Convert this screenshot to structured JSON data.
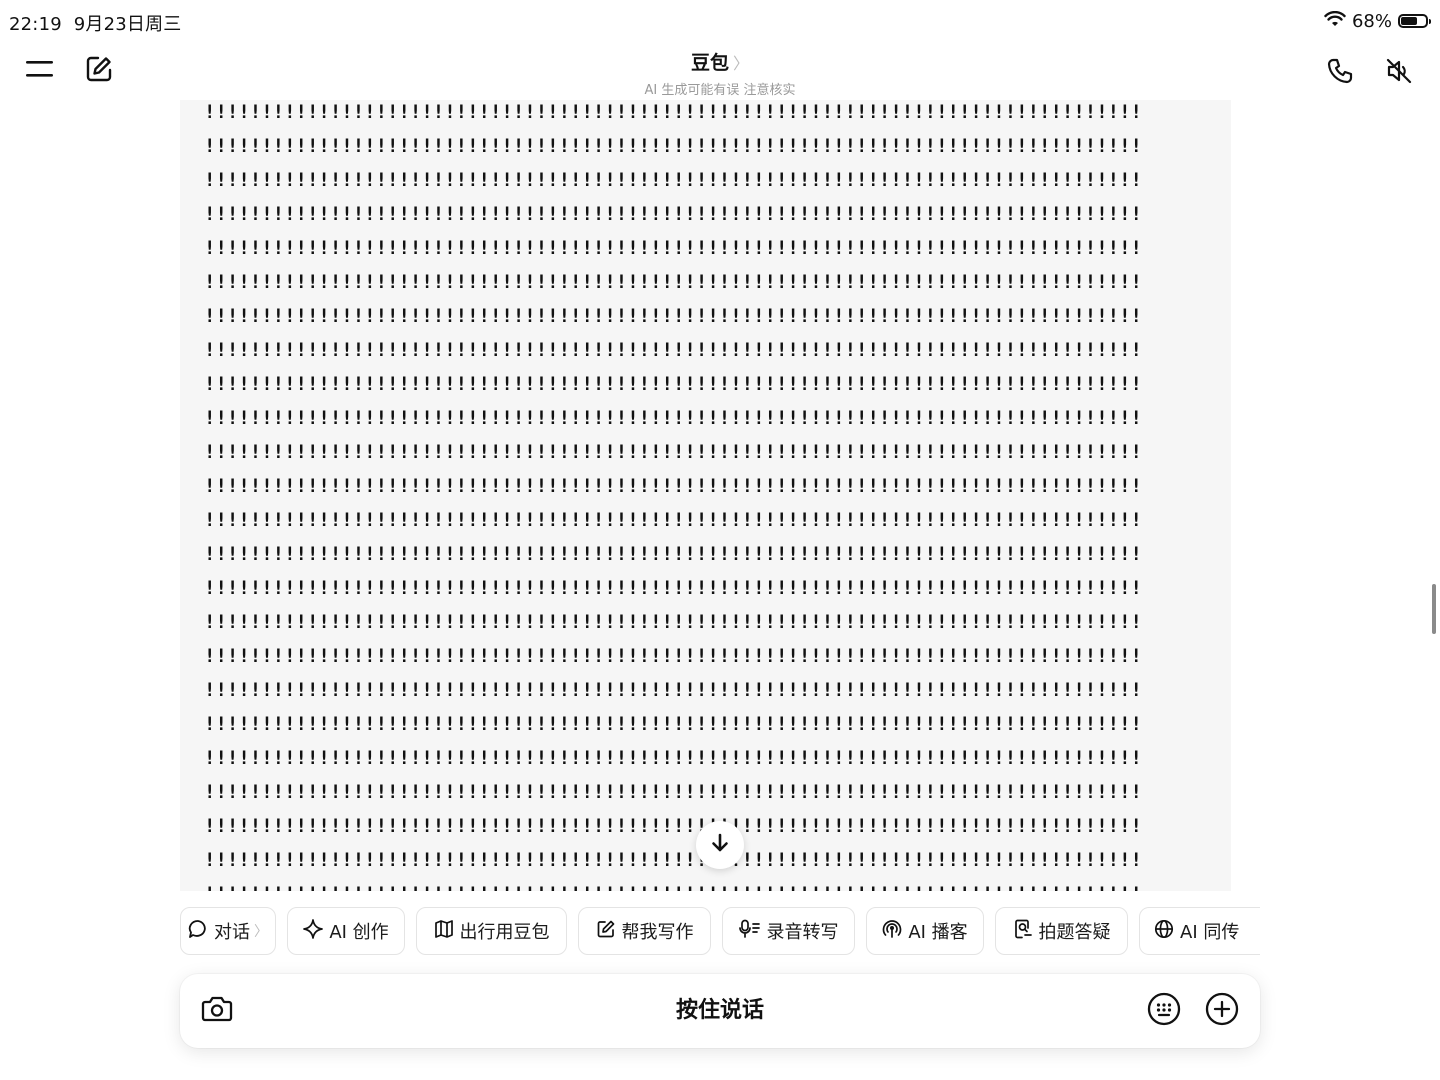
{
  "status_bar": {
    "time": "22:19",
    "date": "9月23日周三",
    "battery_text": "68%",
    "battery_level": 0.68
  },
  "header": {
    "title": "豆包",
    "title_chevron": "〉",
    "subtitle": "AI 生成可能有误 注意核实",
    "icons": [
      "menu-icon",
      "compose-icon",
      "phone-icon",
      "mute-icon"
    ]
  },
  "message": {
    "line_text": "!!!!!!!!!!!!!!!!!!!!!!!!!!!!!!!!!!!!!!!!!!!!!!!!!!!!!!!!!!!!!!!!!!!!!!!!!!!!!!!!!!",
    "visible_line_count": 24
  },
  "chips": [
    {
      "label": "对话",
      "icon": "chat-bubble-icon",
      "chevron": "〉"
    },
    {
      "label": "AI 创作",
      "icon": "sparkle-icon"
    },
    {
      "label": "出行用豆包",
      "icon": "map-icon"
    },
    {
      "label": "帮我写作",
      "icon": "edit-icon"
    },
    {
      "label": "录音转写",
      "icon": "mic-text-icon"
    },
    {
      "label": "AI 播客",
      "icon": "podcast-icon"
    },
    {
      "label": "拍题答疑",
      "icon": "doc-search-icon"
    },
    {
      "label": "AI 同传",
      "icon": "globe-icon"
    }
  ],
  "composer": {
    "hold_to_talk_label": "按住说话",
    "icons": [
      "camera-icon",
      "keyboard-icon",
      "plus-circle-icon"
    ]
  }
}
